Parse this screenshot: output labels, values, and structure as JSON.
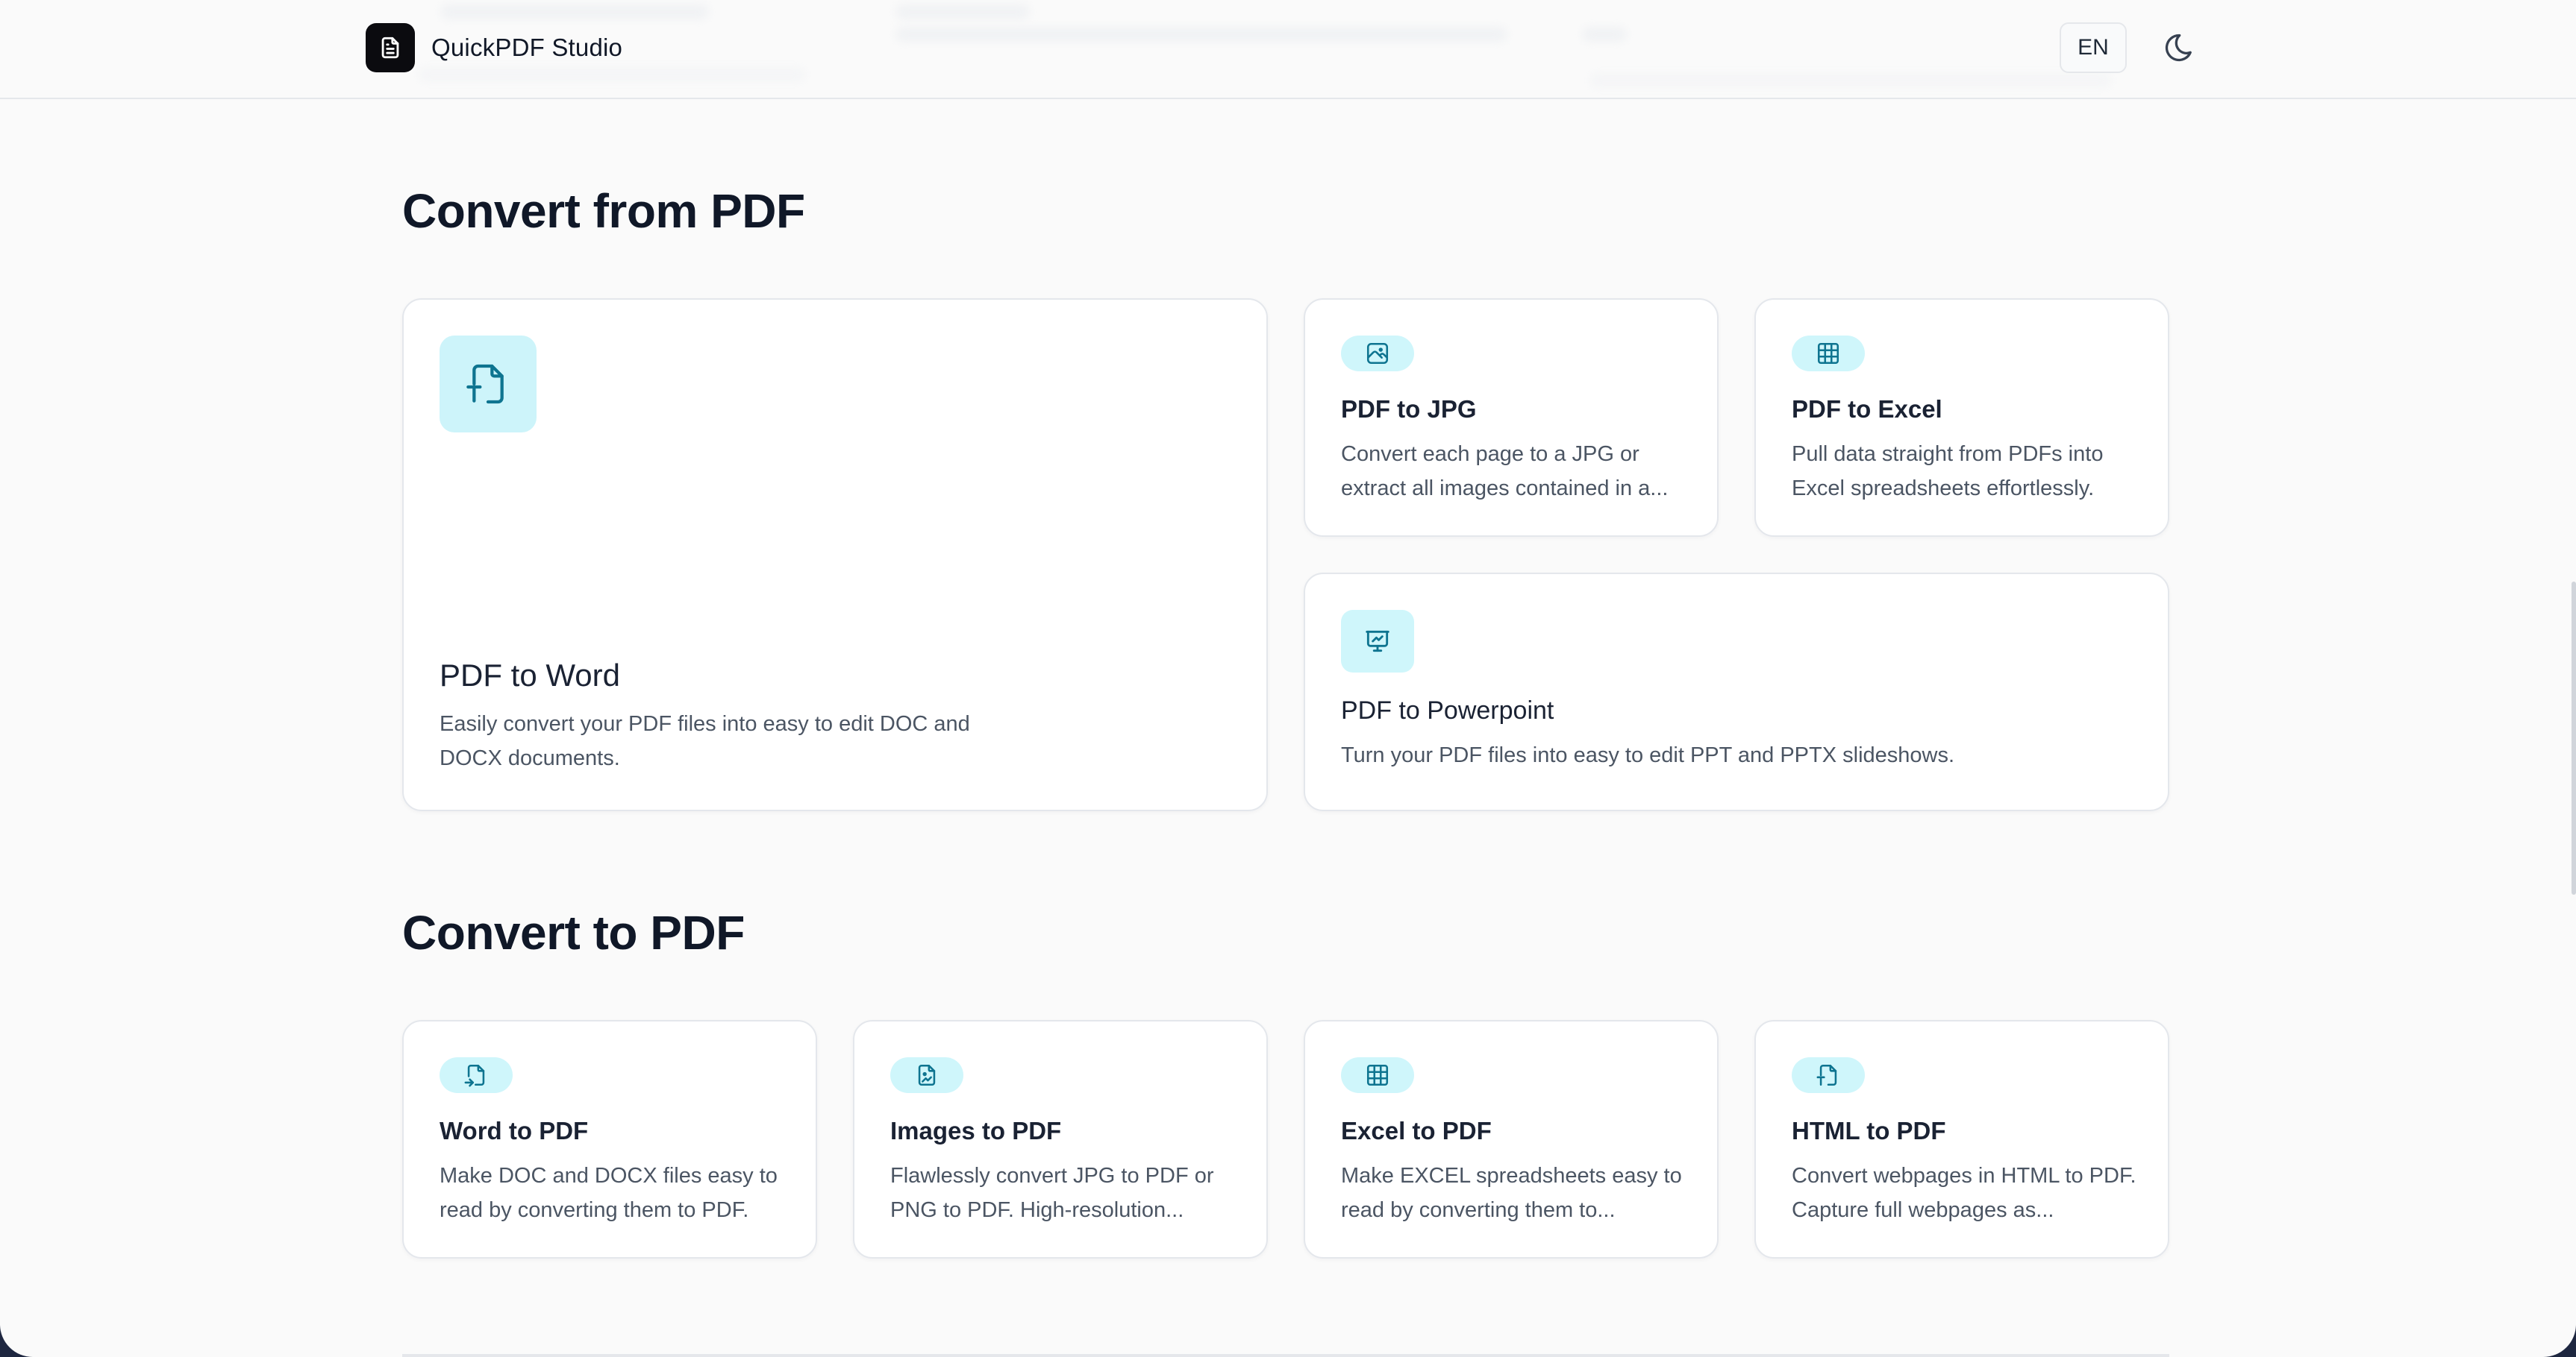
{
  "header": {
    "brand_name": "QuickPDF Studio",
    "language": "EN",
    "logo_icon": "document-icon",
    "theme_icon": "moon-icon"
  },
  "colors": {
    "accent_bg": "#cff6fb",
    "accent_icon": "#0e7490",
    "page_bg": "#fafafa",
    "card_border": "#e4e7ec"
  },
  "convert_from": {
    "title": "Convert from PDF",
    "tools": [
      {
        "icon": "file-type-icon",
        "title": "PDF to Word",
        "description": "Easily convert your PDF files into easy to edit DOC and DOCX documents."
      },
      {
        "icon": "photo-icon",
        "title": "PDF to JPG",
        "description": "Convert each page to a JPG or extract all images contained in a..."
      },
      {
        "icon": "table-icon",
        "title": "PDF to Excel",
        "description": "Pull data straight from PDFs into Excel spreadsheets effortlessly."
      },
      {
        "icon": "presentation-icon",
        "title": "PDF to Powerpoint",
        "description": "Turn your PDF files into easy to edit PPT and PPTX slideshows."
      }
    ]
  },
  "convert_to": {
    "title": "Convert to PDF",
    "tools": [
      {
        "icon": "file-import-icon",
        "title": "Word to PDF",
        "description": "Make DOC and DOCX files easy to read by converting them to PDF."
      },
      {
        "icon": "file-image-icon",
        "title": "Images to PDF",
        "description": "Flawlessly convert JPG to PDF or PNG to PDF. High-resolution..."
      },
      {
        "icon": "table-icon",
        "title": "Excel to PDF",
        "description": "Make EXCEL spreadsheets easy to read by converting them to..."
      },
      {
        "icon": "file-type-icon",
        "title": "HTML to PDF",
        "description": "Convert webpages in HTML to PDF. Capture full webpages as..."
      }
    ]
  }
}
